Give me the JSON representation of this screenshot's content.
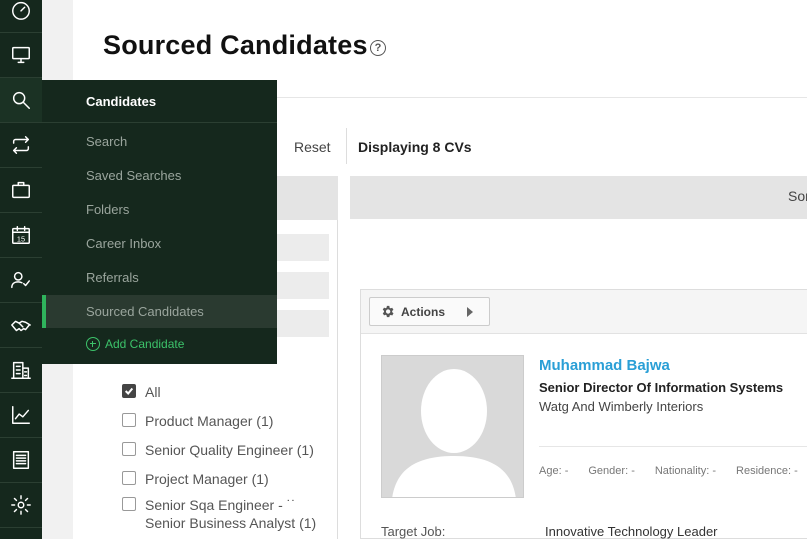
{
  "header": {
    "title": "Sourced Candidates",
    "help_glyph": "?"
  },
  "toolbar": {
    "reset_label": "Reset",
    "displaying_text": "Displaying 8 CVs"
  },
  "sort": {
    "label": "Sor"
  },
  "rail": {
    "icons": [
      "dashboard-icon",
      "monitor-icon",
      "search-icon",
      "repeat-icon",
      "briefcase-icon",
      "calendar-icon",
      "user-check-icon",
      "handshake-icon",
      "building-icon",
      "chart-icon",
      "document-icon",
      "gear-icon"
    ],
    "calendar_day": "15"
  },
  "flyout": {
    "title": "Candidates",
    "items": [
      {
        "label": "Search"
      },
      {
        "label": "Saved Searches"
      },
      {
        "label": "Folders"
      },
      {
        "label": "Career Inbox"
      },
      {
        "label": "Referrals"
      },
      {
        "label": "Sourced Candidates",
        "active": true
      }
    ],
    "add_label": "Add Candidate"
  },
  "filters": [
    {
      "label": "All",
      "checked": true
    },
    {
      "label": "Product Manager (1)",
      "checked": false
    },
    {
      "label": "Senior Quality Engineer (1)",
      "checked": false
    },
    {
      "label": "Project Manager (1)",
      "checked": false
    },
    {
      "label": "Senior Sqa Engineer - ˙˙",
      "checked": false
    },
    {
      "label": "Senior Business Analyst (1)",
      "checked": false
    }
  ],
  "card": {
    "actions_label": "Actions",
    "name": "Muhammad Bajwa",
    "job_title": "Senior Director Of Information Systems",
    "company": "Watg And Wimberly Interiors",
    "details": [
      {
        "label": "Age:",
        "value": "-"
      },
      {
        "label": "Gender:",
        "value": "-"
      },
      {
        "label": "Nationality:",
        "value": "-"
      },
      {
        "label": "Residence:",
        "value": "-"
      }
    ],
    "target_job_label": "Target Job:",
    "target_job_value": "Innovative Technology Leader"
  },
  "colors": {
    "rail_bg": "#15281d",
    "accent_green": "#2fb35c",
    "link_blue": "#2a9fd6"
  }
}
